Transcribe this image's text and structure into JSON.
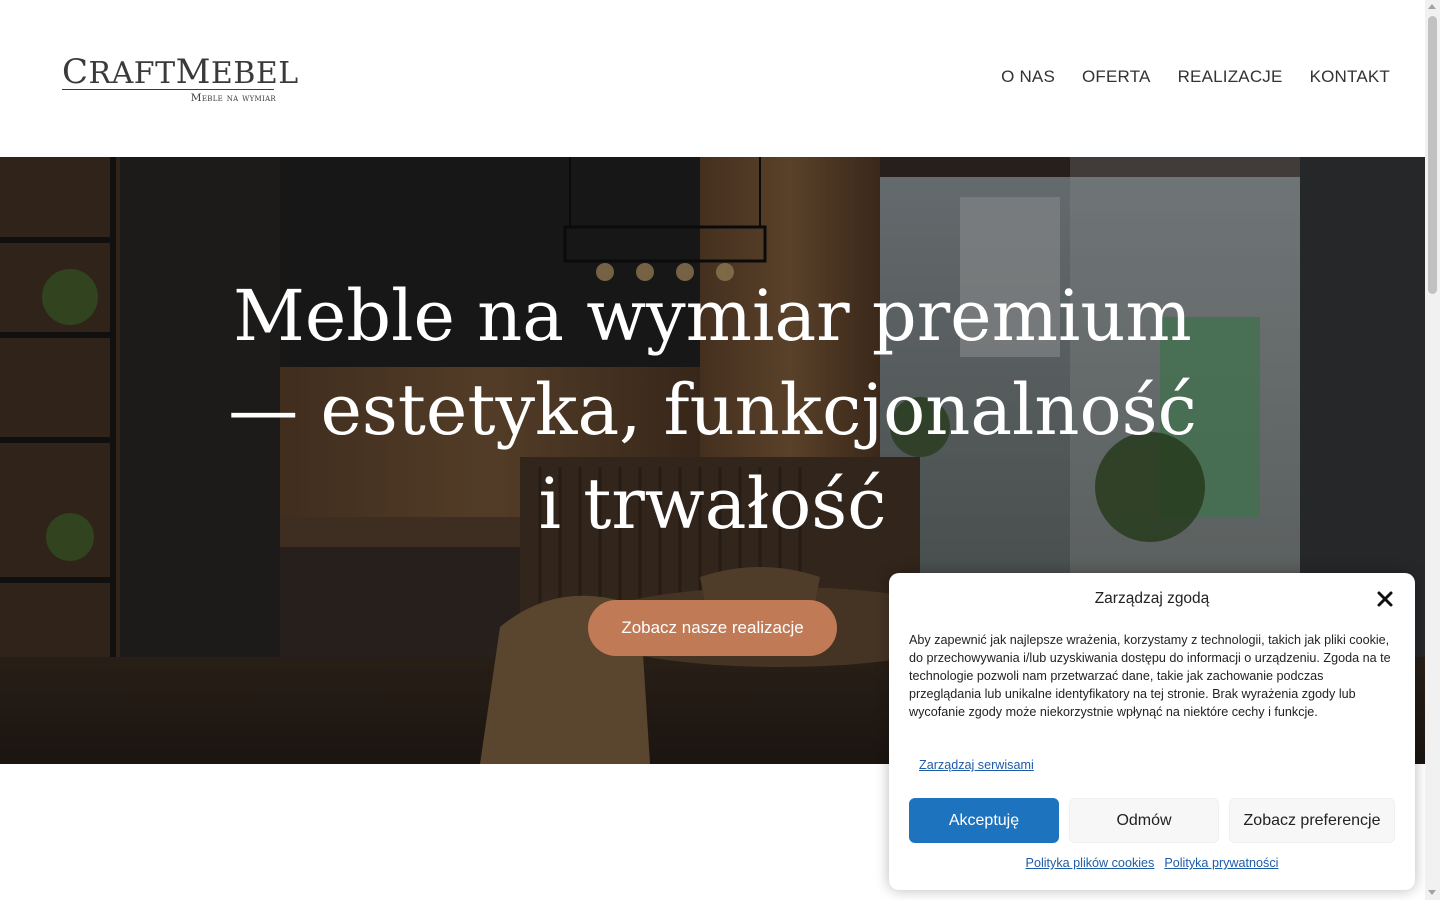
{
  "header": {
    "logo_main_first": "C",
    "logo_main_rest": "RAFT",
    "logo_main_second": "M",
    "logo_main_rest2": "EBEL",
    "logo_sub": "Meble na wymiar",
    "nav": [
      "O NAS",
      "OFERTA",
      "REALIZACJE",
      "KONTAKT"
    ]
  },
  "hero": {
    "title_line1": "Meble na wymiar premium",
    "title_line2": "— estetyka, funkcjonalność",
    "title_line3": "i trwałość",
    "cta_label": "Zobacz nasze realizacje",
    "cta_color": "#c07a55"
  },
  "consent": {
    "title": "Zarządzaj zgodą",
    "text": "Aby zapewnić jak najlepsze wrażenia, korzystamy z technologii, takich jak pliki cookie, do przechowywania i/lub uzyskiwania dostępu do informacji o urządzeniu. Zgoda na te technologie pozwoli nam przetwarzać dane, takie jak zachowanie podczas przeglądania lub unikalne identyfikatory na tej stronie. Brak wyrażenia zgody lub wycofanie zgody może niekorzystnie wpłynąć na niektóre cechy i funkcje.",
    "manage_services": "Zarządzaj serwisami",
    "accept": "Akceptuję",
    "deny": "Odmów",
    "preferences": "Zobacz preferencje",
    "cookie_policy": "Polityka plików cookies",
    "privacy_policy": "Polityka prywatności",
    "accent_color": "#1e73be",
    "close_icon": "close-icon"
  }
}
